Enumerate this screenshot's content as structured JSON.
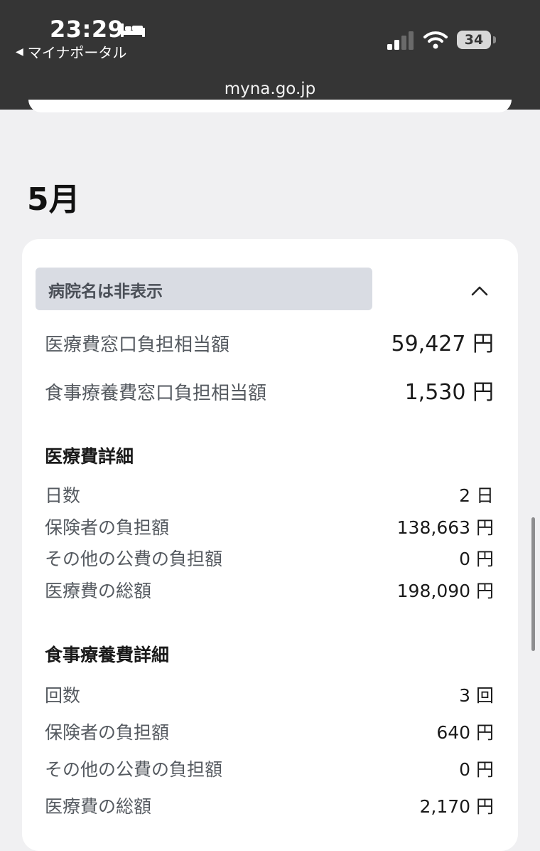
{
  "status_bar": {
    "time": "23:29",
    "back_label": "マイナポータル",
    "battery": "34",
    "url": "myna.go.jp"
  },
  "icons": {
    "bed": "bed-icon",
    "signal": "cellular-signal-icon",
    "wifi": "wifi-icon",
    "collapse": "chevron-up-icon"
  },
  "month": "5月",
  "hospital": {
    "name": "病院名は非表示"
  },
  "summary": {
    "medical_label": "医療費窓口負担相当額",
    "medical_value": "59,427 円",
    "meal_label": "食事療養費窓口負担相当額",
    "meal_value": "1,530 円"
  },
  "medical_detail": {
    "title": "医療費詳細",
    "rows": [
      {
        "label": "日数",
        "value": "2 日"
      },
      {
        "label": "保険者の負担額",
        "value": "138,663 円"
      },
      {
        "label": "その他の公費の負担額",
        "value": "0 円"
      },
      {
        "label": "医療費の総額",
        "value": "198,090 円"
      }
    ]
  },
  "meal_detail": {
    "title": "食事療養費詳細",
    "rows": [
      {
        "label": "回数",
        "value": "3 回"
      },
      {
        "label": "保険者の負担額",
        "value": "640 円"
      },
      {
        "label": "その他の公費の負担額",
        "value": "0 円"
      },
      {
        "label": "医療費の総額",
        "value": "2,170 円"
      }
    ]
  }
}
